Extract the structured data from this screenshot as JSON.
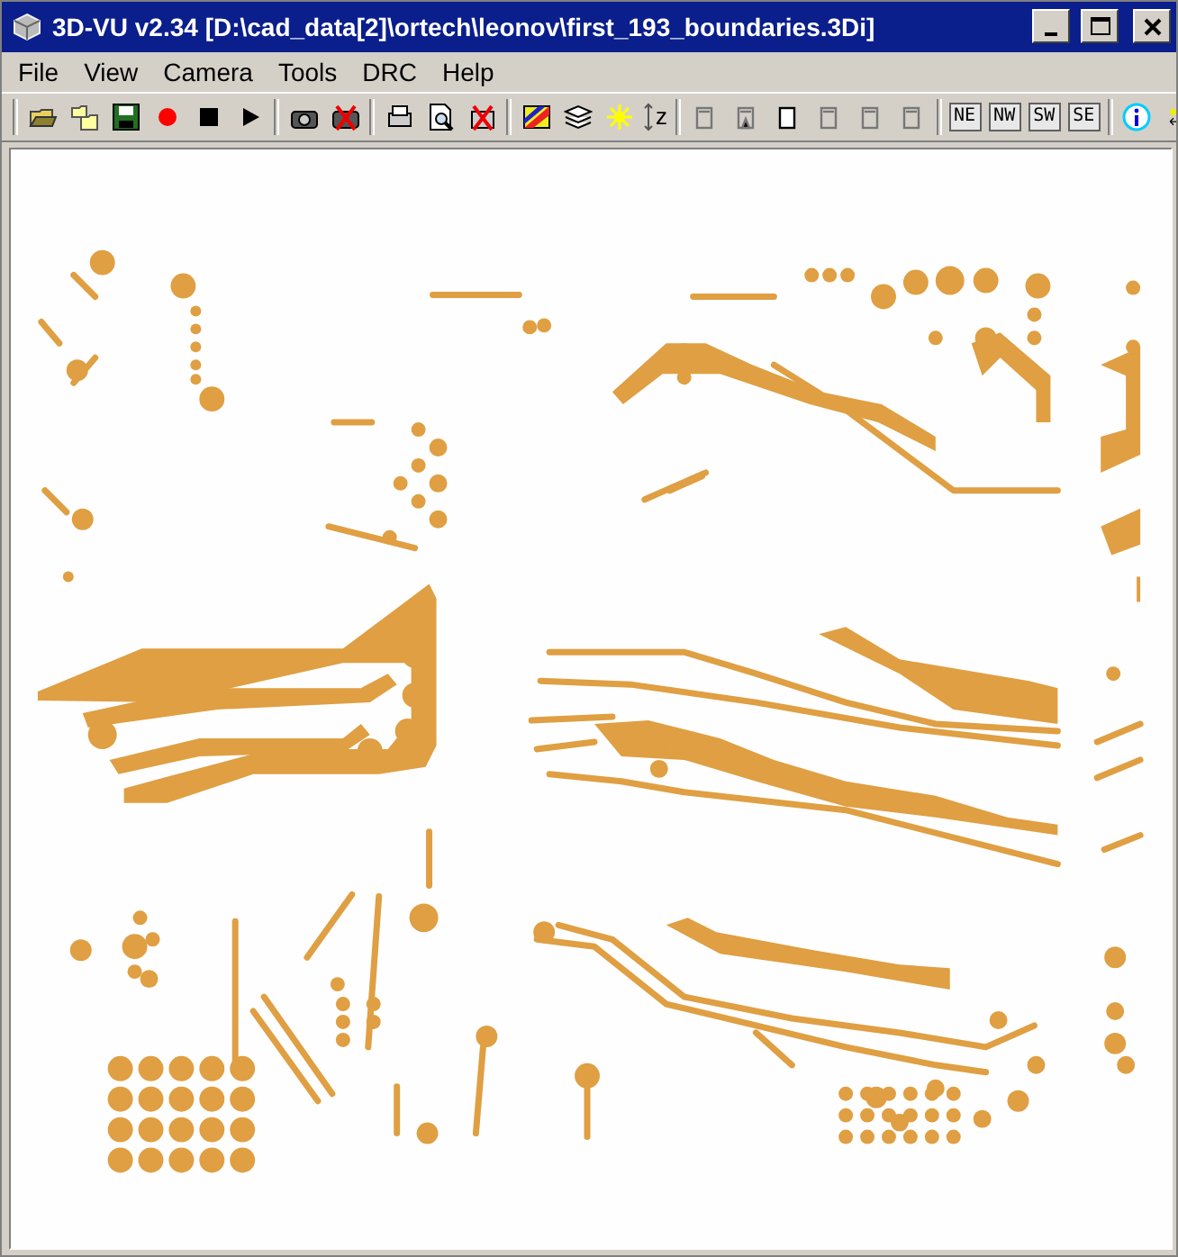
{
  "window": {
    "title": "3D-VU v2.34 [D:\\cad_data[2]\\ortech\\leonov\\first_193_boundaries.3Di]"
  },
  "menu": [
    "File",
    "View",
    "Camera",
    "Tools",
    "DRC",
    "Help"
  ],
  "toolbar": {
    "z_label": "z",
    "view_buttons": [
      "NE",
      "NW",
      "SW",
      "SE"
    ]
  }
}
